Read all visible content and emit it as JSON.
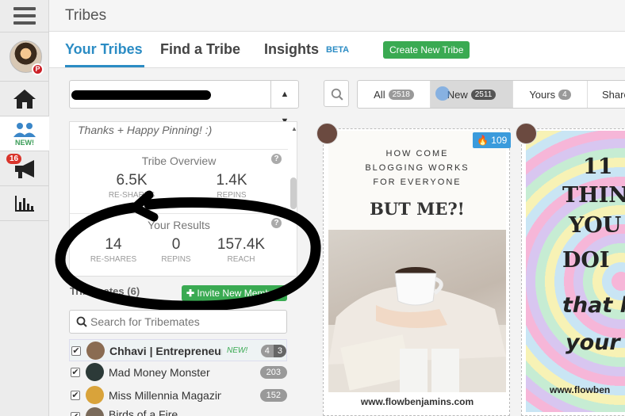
{
  "app": {
    "title": "Tribes"
  },
  "rail": {
    "home_label": "",
    "tribes_new": "NEW!",
    "notifications": "16"
  },
  "tabs": [
    {
      "label": "Your Tribes"
    },
    {
      "label": "Find a Tribe"
    },
    {
      "label": "Insights"
    }
  ],
  "beta": "BETA",
  "create_button": "Create New Tribe",
  "tribe_description": "Thanks + Happy Pinning! :)",
  "overview": {
    "title": "Tribe Overview",
    "stats": [
      {
        "value": "6.5K",
        "label": "RE-SHARES"
      },
      {
        "value": "1.4K",
        "label": "REPINS"
      }
    ]
  },
  "results": {
    "title": "Your Results",
    "stats": [
      {
        "value": "14",
        "label": "RE-SHARES"
      },
      {
        "value": "0",
        "label": "REPINS"
      },
      {
        "value": "157.4K",
        "label": "REACH"
      }
    ]
  },
  "tribemates_label": "Tribemates (6)",
  "invite_button": "Invite New Members",
  "member_search": {
    "placeholder": "Search for Tribemates"
  },
  "members": [
    {
      "name": "Chhavi | Entrepreneur",
      "tag": "NEW!",
      "count_a": "4",
      "count_b": "3"
    },
    {
      "name": "Mad Money Monster",
      "count": "203"
    },
    {
      "name": "Miss Millennia Magazine",
      "count": "152"
    },
    {
      "name": "Birds of a Fire",
      "count": "..."
    }
  ],
  "filters": [
    {
      "label": "All",
      "count": "2518"
    },
    {
      "label": "New",
      "count": "2511"
    },
    {
      "label": "Yours",
      "count": "4"
    },
    {
      "label": "Shares",
      "count": ""
    }
  ],
  "pins": {
    "pin1": {
      "fire_count": "109",
      "line1": "HOW COME",
      "line2": "BLOGGING WORKS",
      "line3": "FOR EVERYONE",
      "headline": "BUT ME?!",
      "footer": "www.flowbenjamins.com"
    },
    "pin2": {
      "line1": "11",
      "line2": "THIN",
      "line3": "YOU",
      "line4": "DOI",
      "line5": "that h",
      "line6": "your",
      "footer": "www.flowben"
    }
  },
  "colors": {
    "accent": "#2b8cc4",
    "green": "#3aaa52",
    "pinterest": "#cb2027"
  }
}
